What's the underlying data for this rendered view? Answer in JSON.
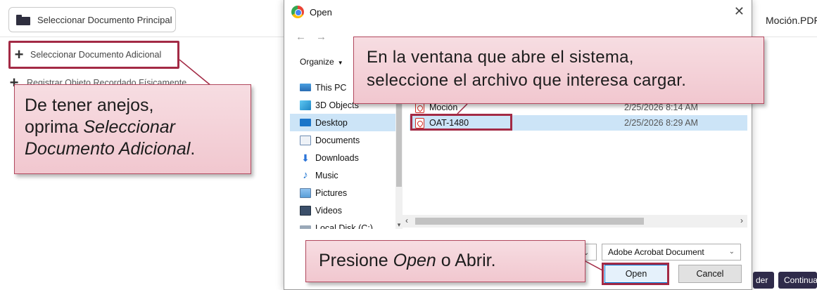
{
  "app": {
    "main_button_label": "Seleccionar Documento Principal",
    "additional_button_label": "Seleccionar Documento Adicional",
    "physical_label": "Registrar Objeto Recordado Físicamente",
    "filename_label": "Moción.PDF",
    "btn_left_label": "der",
    "btn_right_label": "Continua"
  },
  "dialog": {
    "title": "Open",
    "close_label": "✕",
    "organize_label": "Organize",
    "nav_items": [
      {
        "label": "This PC",
        "icon": "this-pc-icon"
      },
      {
        "label": "3D Objects",
        "icon": "3d-objects-icon"
      },
      {
        "label": "Desktop",
        "icon": "desktop-icon",
        "selected": true
      },
      {
        "label": "Documents",
        "icon": "documents-icon"
      },
      {
        "label": "Downloads",
        "icon": "downloads-icon"
      },
      {
        "label": "Music",
        "icon": "music-icon"
      },
      {
        "label": "Pictures",
        "icon": "pictures-icon"
      },
      {
        "label": "Videos",
        "icon": "videos-icon"
      },
      {
        "label": "Local Disk (C:)",
        "icon": "local-disk-icon"
      }
    ],
    "files": [
      {
        "name": "Moción",
        "date": "2/25/2026 8:14 AM"
      },
      {
        "name": "OAT-1480",
        "date": "2/25/2026 8:29 AM",
        "selected": true
      }
    ],
    "filetype_value": "Adobe Acrobat Document",
    "open_label": "Open",
    "cancel_label": "Cancel"
  },
  "callouts": {
    "left_line1": "De tener anejos,",
    "left_line2a": "oprima ",
    "left_line2b": "Seleccionar",
    "left_line3": "Documento Adicional",
    "left_line3_end": ".",
    "top_line1": "En la ventana que abre el sistema,",
    "top_line2": "seleccione el archivo que interesa cargar.",
    "bottom_a": "Presione ",
    "bottom_b": "Open",
    "bottom_c": " o Abrir."
  },
  "colors": {
    "accent_outline": "#a32a45",
    "callout_fill": "#f1c7cf",
    "selection": "#cce4f7",
    "dark_button": "#2f2b4a"
  }
}
